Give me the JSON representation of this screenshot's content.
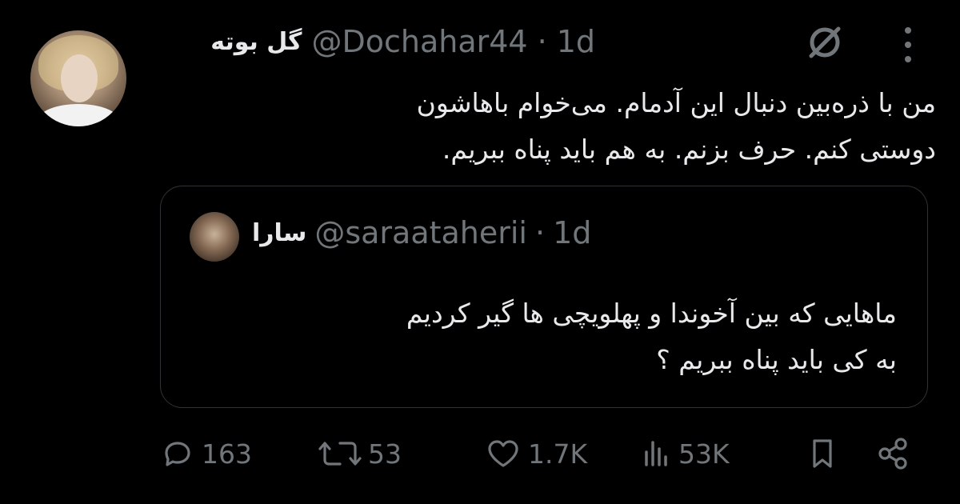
{
  "author": {
    "display_name": "گل بوته",
    "handle": "@Dochahar44",
    "separator": "·",
    "time": "1d"
  },
  "tweet": {
    "text": "من با ذره‌بین دنبال این آدمام. می‌خوام باهاشون دوستی کنم. حرف بزنم. به هم باید پناه ببریم."
  },
  "quote": {
    "display_name": "سارا",
    "handle": "@saraataherii",
    "separator": "·",
    "time": "1d",
    "line1": "ماهایی که بین آخوندا و پهلویچی ها گیر کردیم",
    "line2": "به کی باید پناه ببریم ؟"
  },
  "actions": {
    "replies": "163",
    "retweets": "53",
    "likes": "1.7K",
    "views": "53K"
  },
  "icons": {
    "grok": "grok-icon",
    "more": "more-vertical-icon",
    "reply": "reply-icon",
    "retweet": "retweet-icon",
    "like": "heart-icon",
    "views": "views-icon",
    "bookmark": "bookmark-icon",
    "share": "share-icon"
  },
  "colors": {
    "background": "#000000",
    "text": "#e7e9ea",
    "secondary": "#71767b",
    "border": "#2f3336"
  }
}
